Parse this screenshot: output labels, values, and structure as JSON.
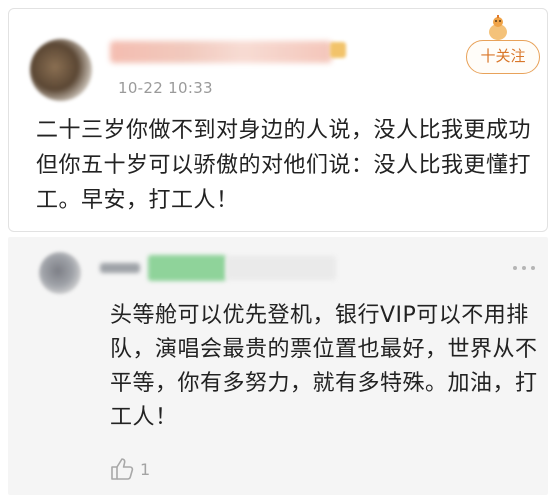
{
  "post": {
    "time": "10-22 10:33",
    "follow_label": "十关注",
    "text": "二十三岁你做不到对身边的人说，没人比我更成功 但你五十岁可以骄傲的对他们说：没人比我更懂打工。早安，打工人！"
  },
  "reply": {
    "text": "头等舱可以优先登机，银行VIP可以不用排队，演唱会最贵的票位置也最好，世界从不平等，你有多努力，就有多特殊。加油，打工人！",
    "like_count": "1"
  },
  "icons": {
    "follow_mascot": "mascot-icon",
    "more": "more-dots-icon",
    "like": "thumbs-up-icon"
  },
  "colors": {
    "follow_accent": "#e8a25a",
    "follow_text": "#d9772a",
    "reply_bg": "#f5f5f5",
    "muted_text": "#9a9a9a"
  }
}
